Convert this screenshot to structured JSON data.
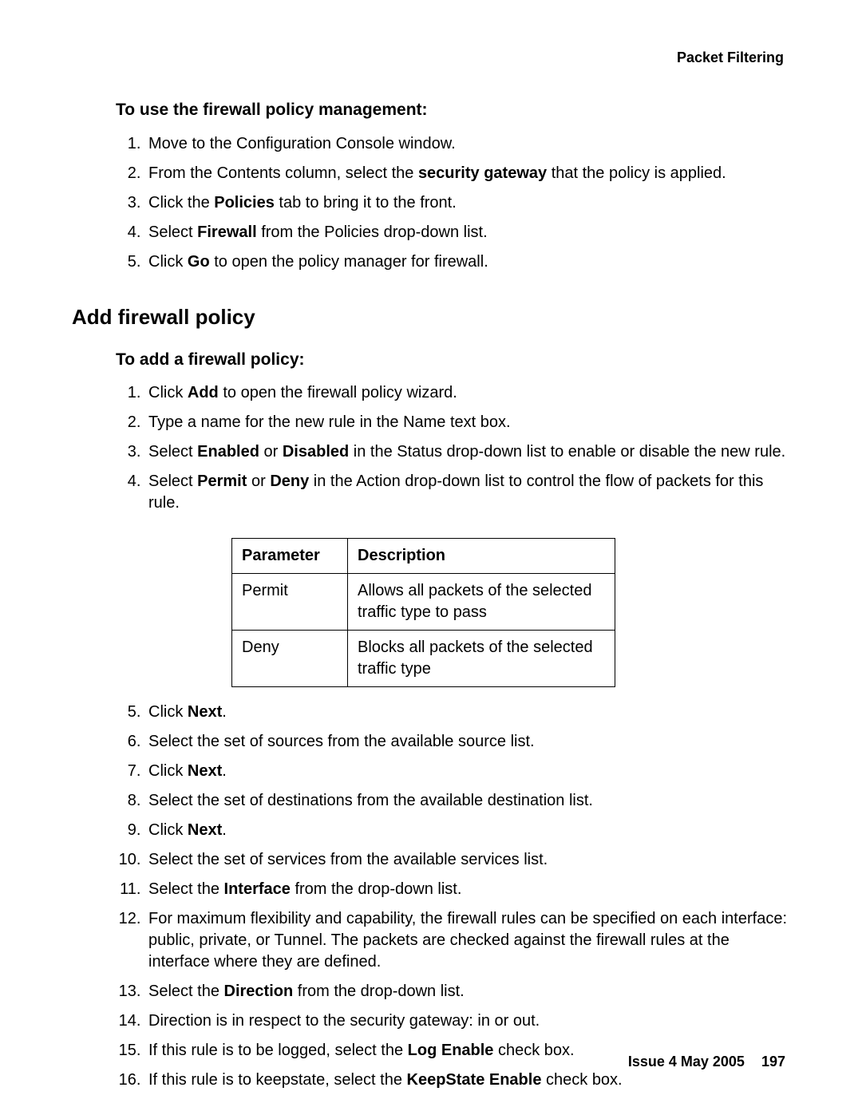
{
  "header": {
    "title": "Packet Filtering"
  },
  "section1": {
    "heading": "To use the firewall policy management:",
    "steps": [
      {
        "text": "Move to the Configuration Console window."
      },
      {
        "pre": "From the Contents column, select the ",
        "bold": "security gateway",
        "post": " that the policy is applied."
      },
      {
        "pre": "Click the ",
        "bold": "Policies",
        "post": " tab to bring it to the front."
      },
      {
        "pre": "Select ",
        "bold": "Firewall",
        "post": " from the Policies drop-down list."
      },
      {
        "pre": "Click ",
        "bold": "Go",
        "post": " to open the policy manager for firewall."
      }
    ]
  },
  "section2": {
    "heading": "Add firewall policy",
    "subheading": "To add a firewall policy:",
    "steps_a": [
      {
        "pre": "Click ",
        "bold": "Add",
        "post": " to open the firewall policy wizard."
      },
      {
        "text": "Type a name for the new rule in the Name text box."
      },
      {
        "pre": "Select ",
        "bold": "Enabled",
        "mid": " or ",
        "bold2": "Disabled",
        "post": " in the Status drop-down list to enable or disable the new rule."
      },
      {
        "pre": "Select ",
        "bold": "Permit",
        "mid": " or ",
        "bold2": "Deny",
        "post": " in the Action drop-down list to control the flow of packets for this rule."
      }
    ],
    "table": {
      "headers": [
        "Parameter",
        "Description"
      ],
      "rows": [
        [
          "Permit",
          "Allows all packets of the selected traffic type to pass"
        ],
        [
          "Deny",
          "Blocks all packets of the selected traffic type"
        ]
      ]
    },
    "steps_b": [
      {
        "pre": "Click ",
        "bold": "Next",
        "post": "."
      },
      {
        "text": "Select the set of sources from the available source list."
      },
      {
        "pre": "Click ",
        "bold": "Next",
        "post": "."
      },
      {
        "text": "Select the set of destinations from the available destination list."
      },
      {
        "pre": "Click ",
        "bold": "Next",
        "post": "."
      },
      {
        "text": "Select the set of services from the available services list."
      },
      {
        "pre": "Select the ",
        "bold": "Interface",
        "post": " from the drop-down list."
      },
      {
        "text": "For maximum flexibility and capability, the firewall rules can be specified on each interface: public, private, or Tunnel. The packets are checked against the firewall rules at the interface where they are defined."
      },
      {
        "pre": "Select the ",
        "bold": "Direction",
        "post": " from the drop-down list."
      },
      {
        "text": "Direction is in respect to the security gateway: in or out."
      },
      {
        "pre": "If this rule is to be logged, select the ",
        "bold": "Log Enable",
        "post": " check box."
      },
      {
        "pre": "If this rule is to keepstate, select the ",
        "bold": "KeepState Enable",
        "post": " check box."
      }
    ]
  },
  "footer": {
    "issue": "Issue 4   May 2005",
    "page": "197"
  }
}
